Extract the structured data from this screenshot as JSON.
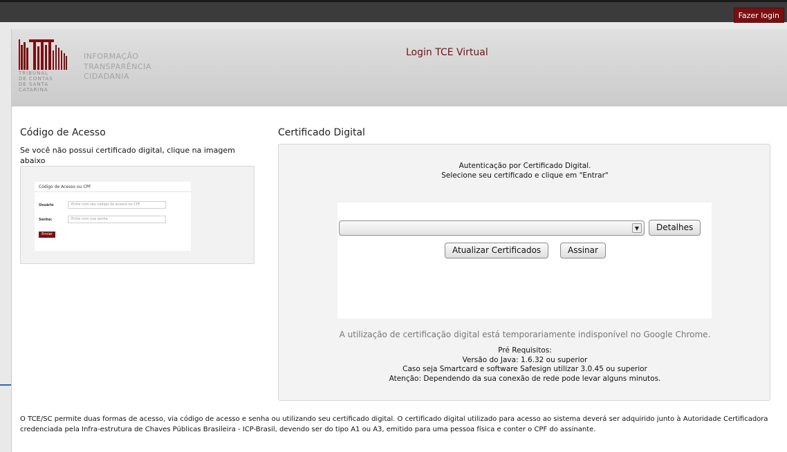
{
  "topbar": {
    "login_button": "Fazer login"
  },
  "header": {
    "title": "Login TCE Virtual",
    "logo": {
      "caption_lines": [
        "TRIBUNAL",
        "DE CONTAS",
        "DE SANTA",
        "CATARINA"
      ],
      "words": [
        "INFORMAÇÃO",
        "TRANSPARÊNCIA",
        "CIDADANIA"
      ]
    }
  },
  "access_code": {
    "title": "Código de Acesso",
    "description": "Se você não possui certificado digital, clique na imagem abaixo",
    "preview": {
      "heading": "Código de Acesso ou CPF",
      "user_label": "Usuário",
      "user_placeholder": "Entre com seu código de acesso ou CPF",
      "password_label": "Senha:",
      "password_placeholder": "Entre com sua senha",
      "submit_label": "Enviar"
    }
  },
  "certificate": {
    "title": "Certificado Digital",
    "intro_line1": "Autenticação por Certificado Digital.",
    "intro_line2": "Selecione seu certificado e clique em \"Entrar\"",
    "select_value": "",
    "details_button": "Detalhes",
    "refresh_button": "Atualizar Certificados",
    "sign_button": "Assinar",
    "chrome_notice": "A utilização de certificação digital está temporariamente indisponível no Google Chrome.",
    "requirements": {
      "heading": "Pré Requisitos:",
      "java": "Versão do Java: 1.6.32 ou superior",
      "smartcard": "Caso seja Smartcard e software Safesign utilizar 3.0.45 ou superior",
      "warning": "Atenção: Dependendo da sua conexão de rede pode levar alguns minutos."
    }
  },
  "footer": {
    "text": "O TCE/SC permite duas formas de acesso, via código de acesso e senha ou utilizando seu certificado digital. O certificado digital utilizado para acesso ao sistema deverá ser adquirido junto à Autoridade Certificadora credenciada pela Infra-estrutura de Chaves Públicas Brasileira - ICP-Brasil, devendo ser do tipo A1 ou A3, emitido para uma pessoa física e conter o CPF do assinante."
  },
  "colors": {
    "brand": "#7a0f12",
    "topbar": "#3b3b3b"
  }
}
